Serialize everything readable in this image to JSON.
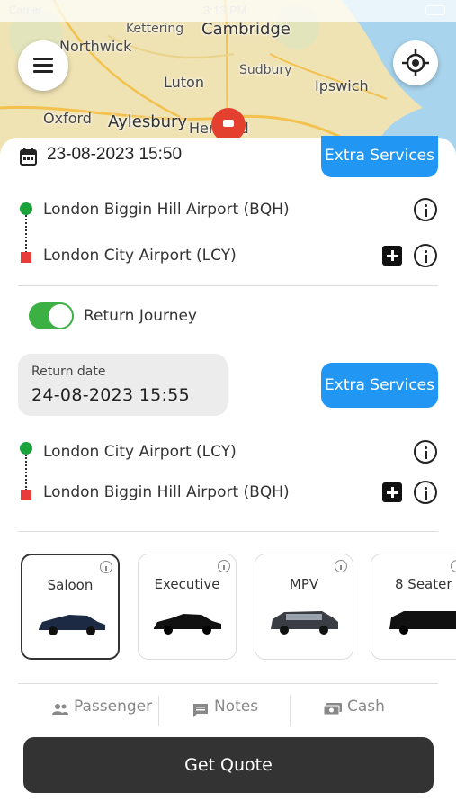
{
  "status_bar": {
    "carrier": "Carrier",
    "time": "3:13 PM"
  },
  "map": {
    "places": [
      "Northwick",
      "Kettering",
      "Cambridge",
      "Sudbury",
      "Luton",
      "Ipswich",
      "Oxford",
      "Aylesbury",
      "Hertford"
    ]
  },
  "outbound": {
    "datetime": "23-08-2023 15:50",
    "extra_services_label": "Extra Services",
    "pickup": "London Biggin Hill Airport (BQH)",
    "dropoff": "London City Airport (LCY)"
  },
  "return_journey": {
    "toggle_label": "Return Journey",
    "toggle_on": true,
    "date_label": "Return date",
    "date_value": "24-08-2023 15:55",
    "extra_services_label": "Extra Services",
    "pickup": "London City Airport (LCY)",
    "dropoff": "London Biggin Hill Airport (BQH)"
  },
  "vehicles": [
    {
      "name": "Saloon",
      "selected": true
    },
    {
      "name": "Executive",
      "selected": false
    },
    {
      "name": "MPV",
      "selected": false
    },
    {
      "name": "8 Seater",
      "selected": false
    }
  ],
  "tabs": {
    "passenger": "Passenger",
    "notes": "Notes",
    "payment": "Cash"
  },
  "quote_button": "Get Quote",
  "colors": {
    "accent_blue": "#2196f3",
    "green": "#1aa33a",
    "red": "#e83b3b",
    "dark": "#333333"
  }
}
